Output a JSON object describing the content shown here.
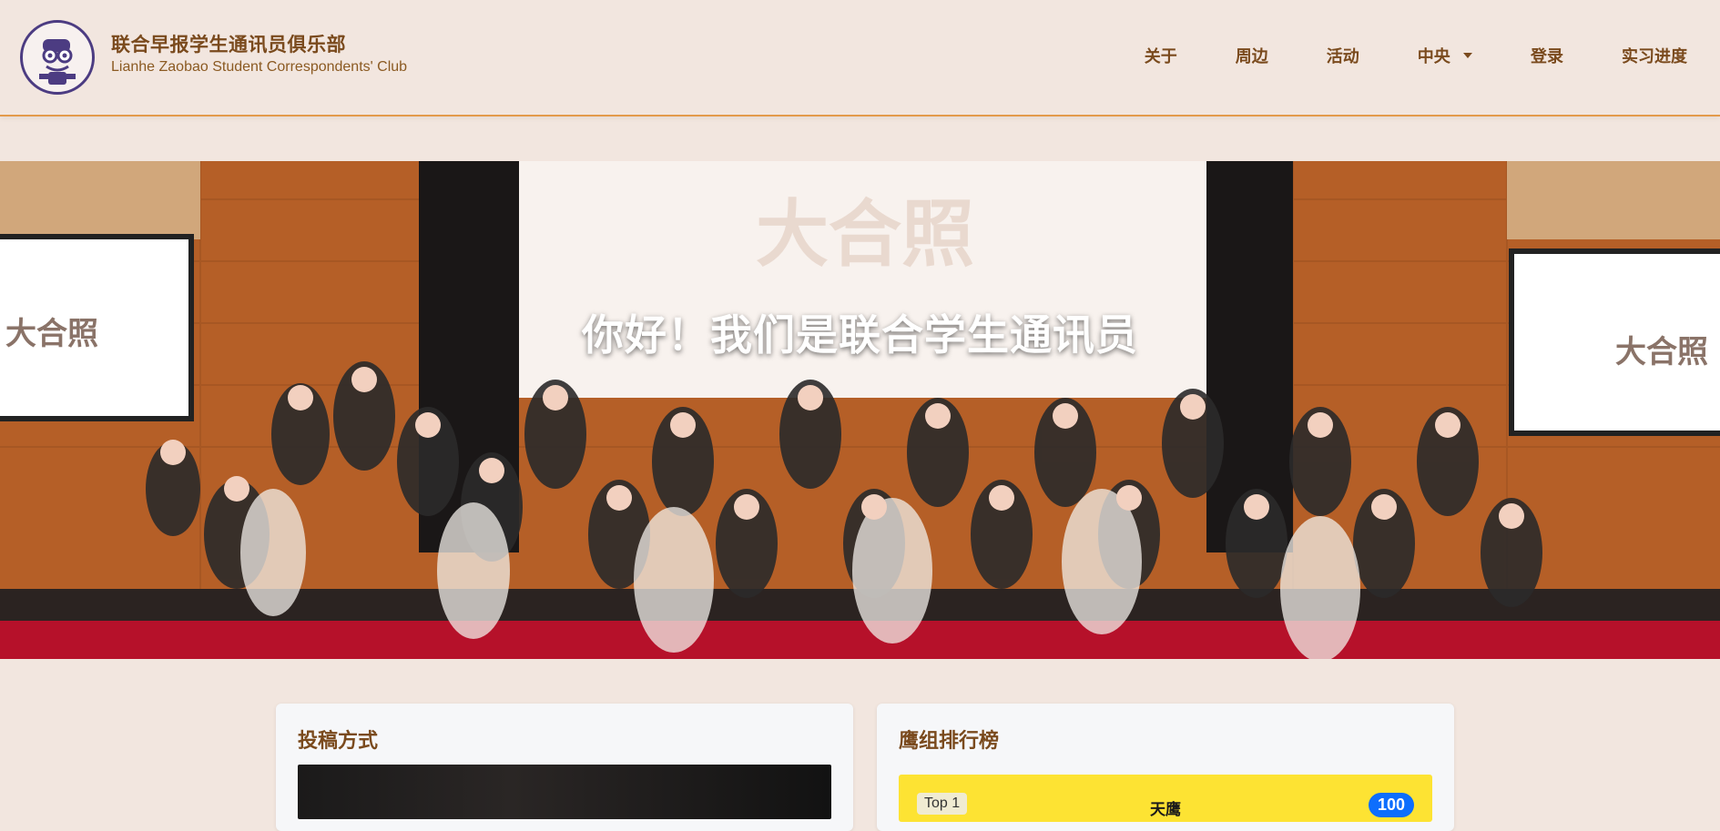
{
  "header": {
    "title_zh": "联合早报学生通讯员俱乐部",
    "title_en": "Lianhe Zaobao Student Correspondents' Club",
    "nav": [
      {
        "label": "关于"
      },
      {
        "label": "周边"
      },
      {
        "label": "活动"
      },
      {
        "label": "中央",
        "has_dropdown": true
      },
      {
        "label": "登录"
      },
      {
        "label": "实习进度"
      }
    ]
  },
  "hero": {
    "heading": "你好！我们是联合学生通讯员",
    "slide_text_main": "大合照",
    "slide_text_left": "大合照",
    "slide_text_right": "大合照"
  },
  "cards": {
    "submit": {
      "title": "投稿方式"
    },
    "leaderboard": {
      "title": "鹰组排行榜",
      "top_entry": {
        "rank": "Top 1",
        "name": "天鹰",
        "score": "100"
      }
    }
  },
  "colors": {
    "brand_brown": "#7a4a1d",
    "accent_orange": "#e39a4b",
    "page_bg": "#f2e6df",
    "leaderboard_yellow": "#fde333",
    "badge_blue": "#0d6efd"
  }
}
